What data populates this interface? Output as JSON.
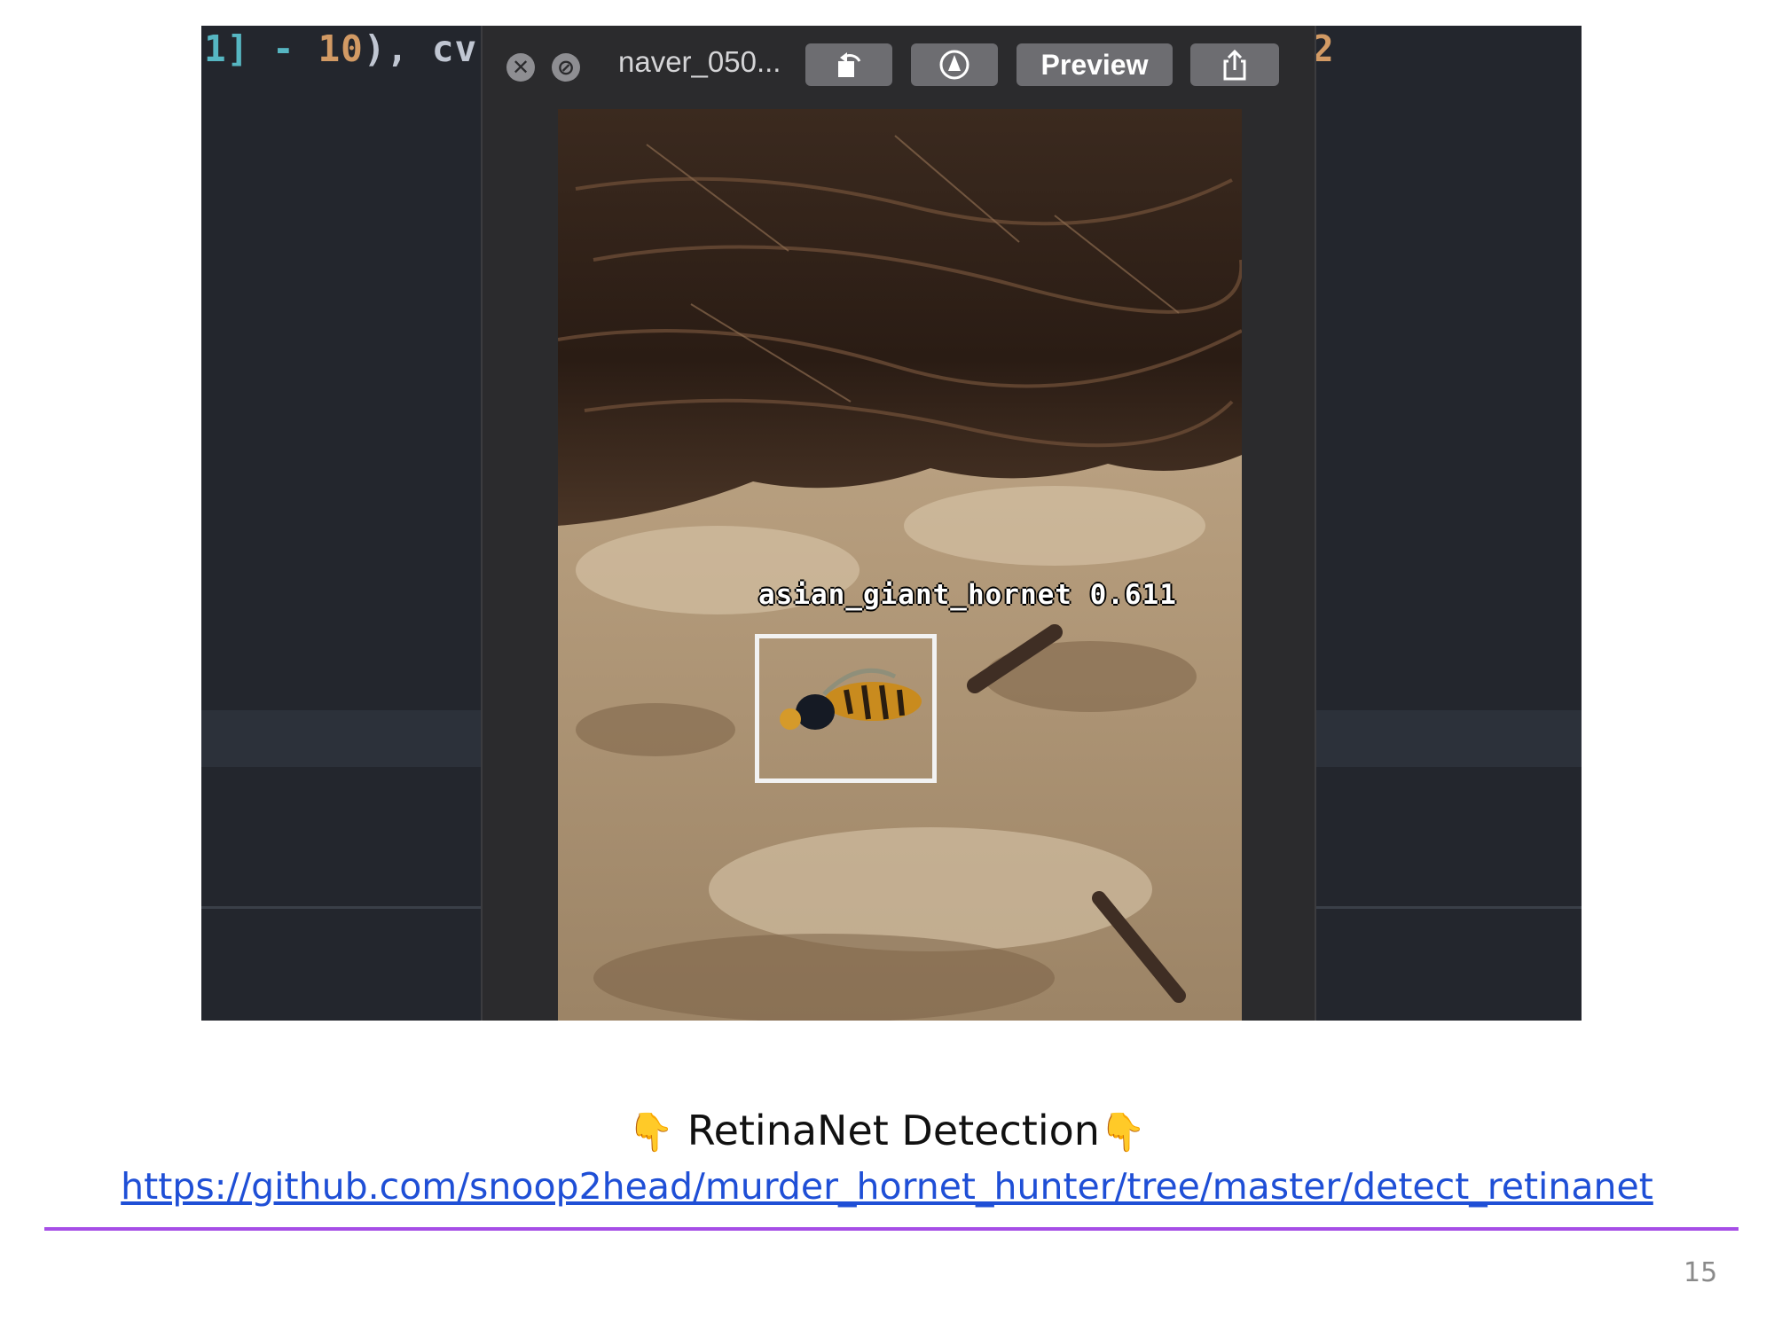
{
  "editor": {
    "code_left": {
      "p1": "1]",
      "p2": " - ",
      "p3": "10",
      "p4": "), cv"
    },
    "code_right": "2"
  },
  "preview": {
    "file_title": "naver_050...",
    "preview_button": "Preview",
    "icons": {
      "close": "close-icon",
      "block": "block-icon",
      "rotate": "rotate-icon",
      "markup": "markup-icon",
      "share": "share-icon"
    },
    "detection": {
      "label": "asian_giant_hornet 0.611",
      "score": 0.611
    }
  },
  "caption": {
    "emoji_left": "👇",
    "text": "RetinaNet Detection",
    "emoji_right": "👇",
    "link": "https://github.com/snoop2head/murder_hornet_hunter/tree/master/detect_retinanet"
  },
  "page_number": "15",
  "colors": {
    "rule": "#a64ee6",
    "link": "#1f4fd6",
    "editor_bg": "#23262d"
  }
}
